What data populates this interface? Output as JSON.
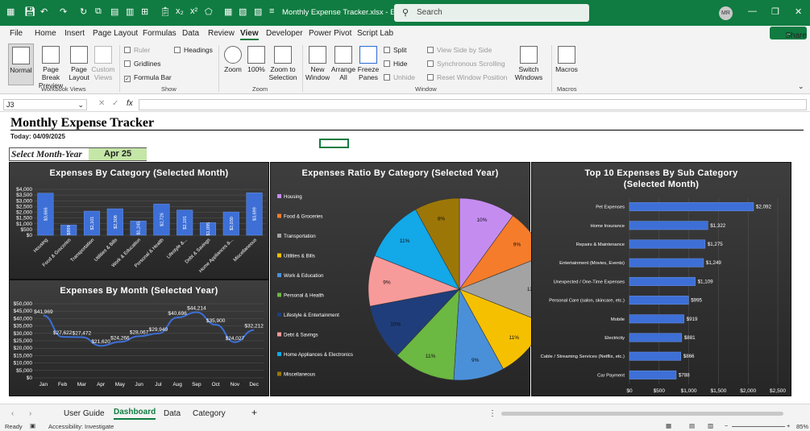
{
  "app": {
    "filename": "Monthly Expense Tracker.xlsx  -  E...",
    "search_placeholder": "Search",
    "user_initials": "MR",
    "share": "Share",
    "accent": "#107c41"
  },
  "menu": [
    "File",
    "Home",
    "Insert",
    "Page Layout",
    "Formulas",
    "Data",
    "Review",
    "View",
    "Developer",
    "Power Pivot",
    "Script Lab"
  ],
  "ribbon": {
    "normal": "Normal",
    "page_break": "Page Break Preview",
    "page_layout": "Page Layout",
    "custom_views": "Custom Views",
    "group_workbook": "Workbook Views",
    "ruler": "Ruler",
    "gridlines": "Gridlines",
    "formula_bar": "Formula Bar",
    "headings": "Headings",
    "group_show": "Show",
    "zoom": "Zoom",
    "zoom100": "100%",
    "zoom_sel": "Zoom to Selection",
    "group_zoom": "Zoom",
    "new_window": "New Window",
    "arrange_all": "Arrange All",
    "freeze": "Freeze Panes",
    "split": "Split",
    "hide": "Hide",
    "unhide": "Unhide",
    "side_by_side": "View Side by Side",
    "sync_scroll": "Synchronous Scrolling",
    "reset_pos": "Reset Window Position",
    "switch": "Switch Windows",
    "group_window": "Window",
    "macros": "Macros",
    "group_macros": "Macros"
  },
  "formula": {
    "namebox": "J3",
    "fx": "fx",
    "value": ""
  },
  "sheet": {
    "title": "Monthly Expense Tracker",
    "today": "Today: 04/09/2025",
    "select_label": "Select Month-Year",
    "select_value": "Apr 25"
  },
  "chart_data": [
    {
      "type": "bar",
      "title": "Expenses By Category (Selected Month)",
      "categories": [
        "Housing",
        "Food & Groceries",
        "Transportation",
        "Utilities & Bills",
        "Work & Education",
        "Personal & Health",
        "Lifestyle &...",
        "Debt & Savings",
        "Home Appliances &...",
        "Miscellaneous"
      ],
      "values": [
        3666,
        899,
        2101,
        2308,
        1245,
        2726,
        2191,
        1095,
        2030,
        3699
      ],
      "labels": [
        "$3,666",
        "$899",
        "$2,101",
        "$2,308",
        "$1,245",
        "$2,726",
        "$2,191",
        "$1,095",
        "$2,030",
        "$3,699"
      ],
      "yticks": [
        "$4,000",
        "$3,500",
        "$3,000",
        "$2,500",
        "$2,000",
        "$1,500",
        "$1,000",
        "$500",
        "$0"
      ],
      "ylim": [
        0,
        4000
      ]
    },
    {
      "type": "line",
      "title": "Expenses By Month (Selected Year)",
      "categories": [
        "Jan",
        "Feb",
        "Mar",
        "Apr",
        "May",
        "Jun",
        "Jul",
        "Aug",
        "Sep",
        "Oct",
        "Nov",
        "Dec"
      ],
      "values": [
        41969,
        27622,
        27472,
        21620,
        24266,
        28067,
        29949,
        40696,
        44214,
        35900,
        24027,
        32212
      ],
      "labels": [
        "$41,969",
        "$27,622",
        "$27,472",
        "$21,620",
        "$24,266",
        "$28,067",
        "$29,949",
        "$40,696",
        "$44,214",
        "$35,900",
        "$24,027",
        "$32,212"
      ],
      "yticks": [
        "$50,000",
        "$45,000",
        "$40,000",
        "$35,000",
        "$30,000",
        "$25,000",
        "$20,000",
        "$15,000",
        "$10,000",
        "$5,000",
        "$0"
      ],
      "ylim": [
        0,
        50000
      ]
    },
    {
      "type": "pie",
      "title": "Expenses Ratio By Category (Selected Year)",
      "categories": [
        "Housing",
        "Food & Groceries",
        "Transportation",
        "Utilities & Bills",
        "Work & Education",
        "Personal & Health",
        "Lifestyle & Entertainment",
        "Debt & Savings",
        "Home Appliances & Electronics",
        "Miscellaneous"
      ],
      "values": [
        10,
        9,
        12,
        11,
        9,
        11,
        10,
        9,
        11,
        8
      ],
      "labels": [
        "10%",
        "9%",
        "12%",
        "11%",
        "9%",
        "11%",
        "10%",
        "9%",
        "11%",
        "8%"
      ],
      "colors": [
        "#c58cf0",
        "#f57c2a",
        "#a3a3a3",
        "#f5c000",
        "#4a90d9",
        "#6bb842",
        "#1f3d7a",
        "#f79a9a",
        "#13a8e8",
        "#9c7708"
      ],
      "legend": "left"
    },
    {
      "type": "bar",
      "title": "Top 10 Expenses By Sub Category (Selected Month)",
      "title_line1": "Top 10 Expenses By Sub Category",
      "title_line2": "(Selected Month)",
      "categories": [
        "Pet Expenses",
        "Home Insurance",
        "Repairs & Maintenance",
        "Entertainment (Movies, Events)",
        "Unexpected / One-Time Expenses",
        "Personal Care (salon, skincare, etc.)",
        "Mobile",
        "Electricity",
        "Cable / Streaming Services (Netflix, etc.)",
        "Car Payment"
      ],
      "values": [
        2092,
        1322,
        1275,
        1249,
        1109,
        995,
        919,
        881,
        866,
        788
      ],
      "labels": [
        "$2,092",
        "$1,322",
        "$1,275",
        "$1,249",
        "$1,109",
        "$995",
        "$919",
        "$881",
        "$866",
        "$788"
      ],
      "xticks": [
        "$0",
        "$500",
        "$1,000",
        "$1,500",
        "$2,000",
        "$2,500"
      ],
      "xlim": [
        0,
        2500
      ]
    }
  ],
  "tabs": [
    "User Guide",
    "Dashboard",
    "Data",
    "Category"
  ],
  "status": {
    "ready": "Ready",
    "accessibility": "Accessibility: Investigate",
    "zoom": "85%"
  }
}
